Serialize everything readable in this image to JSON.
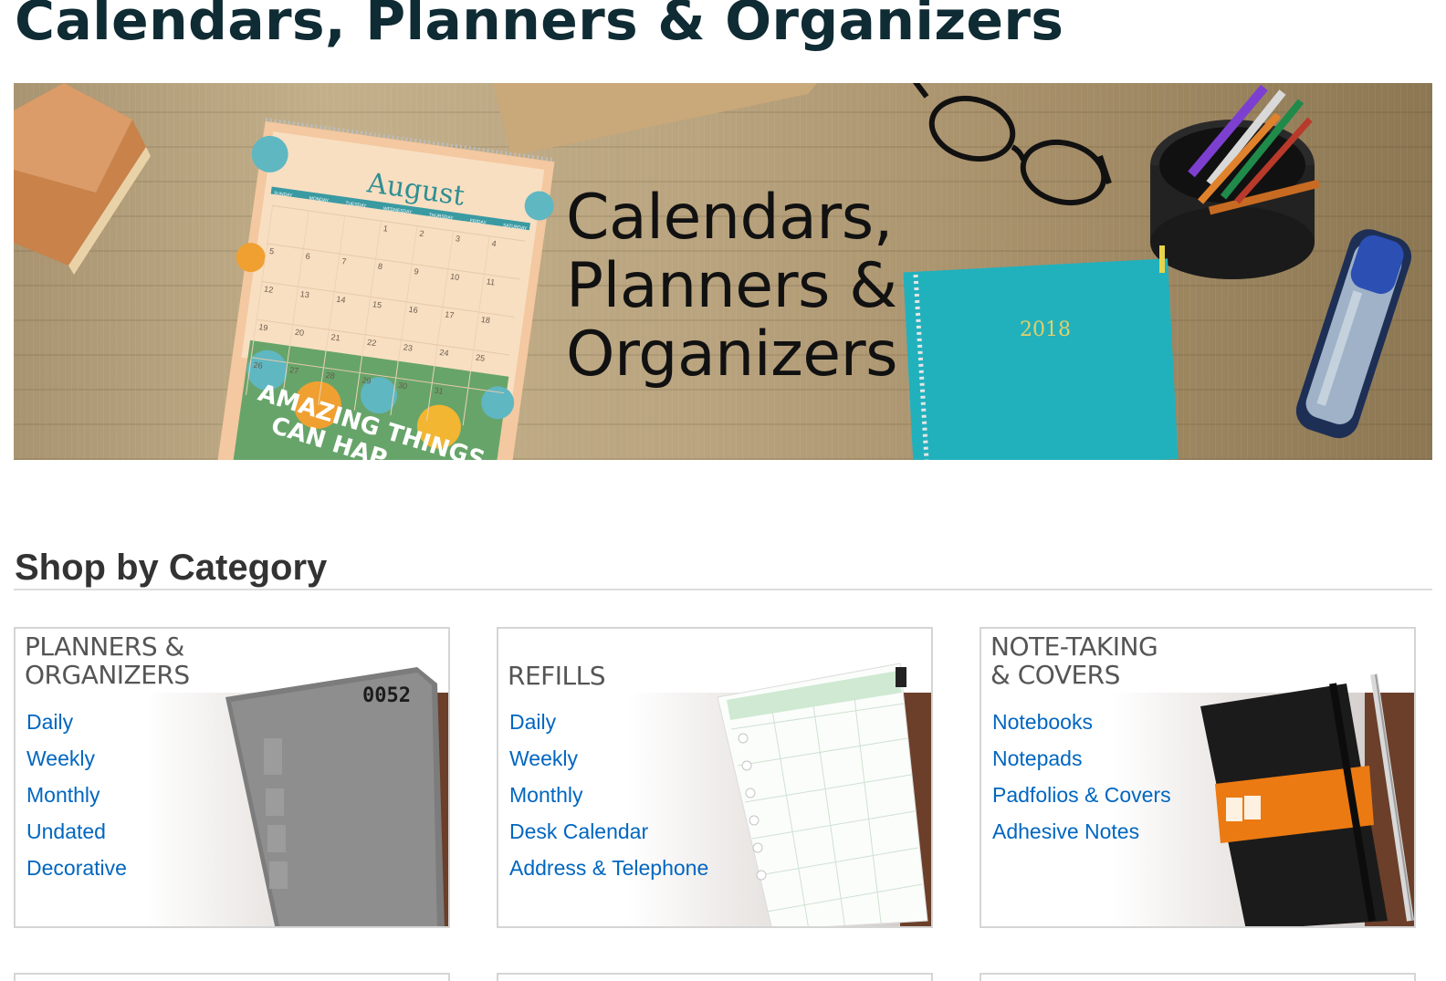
{
  "page": {
    "title": "Calendars, Planners & Organizers"
  },
  "hero": {
    "heading_lines": [
      "Calendars,",
      "Planners &",
      "Organizers"
    ],
    "calendar_month": "August",
    "calendar_caption_1": "AMAZING THINGS",
    "calendar_caption_2": "CAN HAP",
    "planner_year": "2018",
    "calendar_weekdays": [
      "SUNDAY",
      "MONDAY",
      "TUESDAY",
      "WEDNESDAY",
      "THURSDAY",
      "FRIDAY",
      "SATURDAY"
    ],
    "calendar_weeks": [
      [
        "",
        "",
        "",
        "1",
        "2",
        "3",
        "4"
      ],
      [
        "5",
        "6",
        "7",
        "8",
        "9",
        "10",
        "11"
      ],
      [
        "12",
        "13",
        "14",
        "15",
        "16",
        "17",
        "18"
      ],
      [
        "19",
        "20",
        "21",
        "22",
        "23",
        "24",
        "25"
      ],
      [
        "26",
        "27",
        "28",
        "29",
        "30",
        "31",
        ""
      ]
    ]
  },
  "shop": {
    "heading": "Shop by Category",
    "categories": [
      {
        "title": "PLANNERS &\nORGANIZERS",
        "links": [
          "Daily",
          "Weekly",
          "Monthly",
          "Undated",
          "Decorative"
        ],
        "art_label": "0052"
      },
      {
        "title": "REFILLS",
        "links": [
          "Daily",
          "Weekly",
          "Monthly",
          "Desk Calendar",
          "Address & Telephone"
        ]
      },
      {
        "title": "NOTE-TAKING\n& COVERS",
        "links": [
          "Notebooks",
          "Notepads",
          "Padfolios & Covers",
          "Adhesive Notes"
        ]
      }
    ]
  },
  "colors": {
    "title": "#0f2b33",
    "link": "#0066c0",
    "planner_teal": "#1fb5c0",
    "notebook_band": "#ec7a12"
  }
}
